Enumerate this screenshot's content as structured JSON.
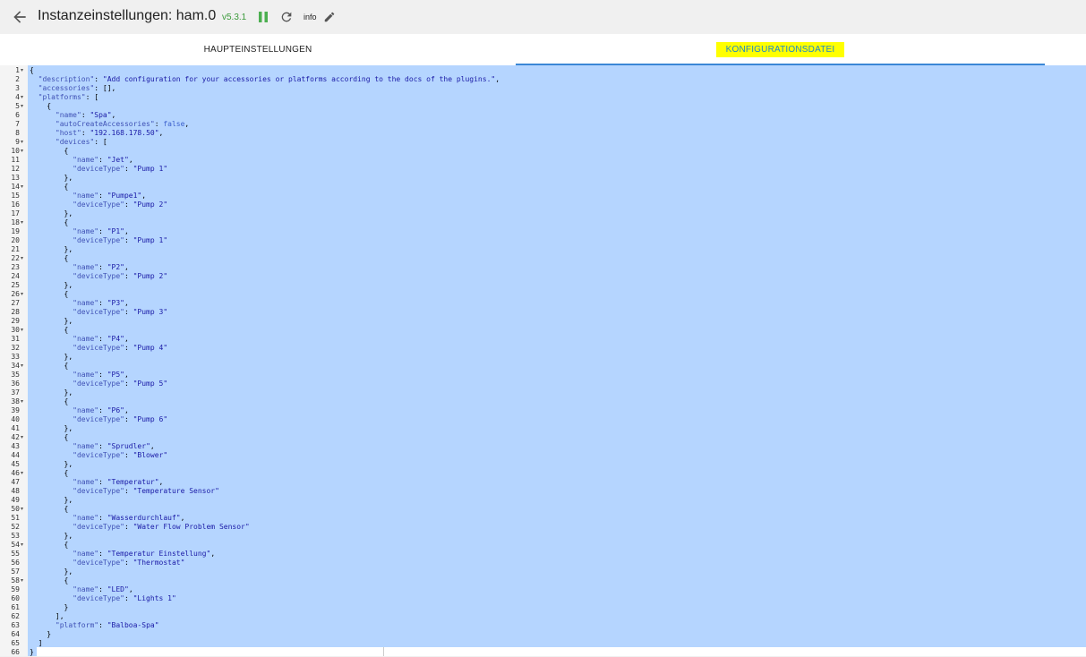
{
  "header": {
    "title": "Instanzeinstellungen: ham.0",
    "version": "v5.3.1",
    "info_label": "info",
    "back_icon": "arrow-left-icon",
    "pause_icon": "pause-icon",
    "reload_icon": "reload-icon",
    "edit_icon": "pencil-icon"
  },
  "tabs": [
    {
      "label": "HAUPTEINSTELLUNGEN",
      "active": false
    },
    {
      "label": "KONFIGURATIONSDATEI",
      "active": true
    }
  ],
  "colors": {
    "accent": "#3b87d6",
    "highlight": "#ffff00",
    "version": "#3a9a3a",
    "selection": "#b5d5ff"
  },
  "editor": {
    "lines": [
      "{",
      "  \"description\": \"Add configuration for your accessories or platforms according to the docs of the plugins.\",",
      "  \"accessories\": [],",
      "  \"platforms\": [",
      "    {",
      "      \"name\": \"Spa\",",
      "      \"autoCreateAccessories\": false,",
      "      \"host\": \"192.168.178.50\",",
      "      \"devices\": [",
      "        {",
      "          \"name\": \"Jet\",",
      "          \"deviceType\": \"Pump 1\"",
      "        },",
      "        {",
      "          \"name\": \"Pumpe1\",",
      "          \"deviceType\": \"Pump 2\"",
      "        },",
      "        {",
      "          \"name\": \"P1\",",
      "          \"deviceType\": \"Pump 1\"",
      "        },",
      "        {",
      "          \"name\": \"P2\",",
      "          \"deviceType\": \"Pump 2\"",
      "        },",
      "        {",
      "          \"name\": \"P3\",",
      "          \"deviceType\": \"Pump 3\"",
      "        },",
      "        {",
      "          \"name\": \"P4\",",
      "          \"deviceType\": \"Pump 4\"",
      "        },",
      "        {",
      "          \"name\": \"P5\",",
      "          \"deviceType\": \"Pump 5\"",
      "        },",
      "        {",
      "          \"name\": \"P6\",",
      "          \"deviceType\": \"Pump 6\"",
      "        },",
      "        {",
      "          \"name\": \"Sprudler\",",
      "          \"deviceType\": \"Blower\"",
      "        },",
      "        {",
      "          \"name\": \"Temperatur\",",
      "          \"deviceType\": \"Temperature Sensor\"",
      "        },",
      "        {",
      "          \"name\": \"Wasserdurchlauf\",",
      "          \"deviceType\": \"Water Flow Problem Sensor\"",
      "        },",
      "        {",
      "          \"name\": \"Temperatur Einstellung\",",
      "          \"deviceType\": \"Thermostat\"",
      "        },",
      "        {",
      "          \"name\": \"LED\",",
      "          \"deviceType\": \"Lights 1\"",
      "        }",
      "      ],",
      "      \"platform\": \"Balboa-Spa\"",
      "    }",
      "  ]",
      "}"
    ],
    "fold_lines": [
      1,
      4,
      5,
      9,
      10,
      14,
      18,
      22,
      26,
      30,
      34,
      38,
      42,
      46,
      50,
      54,
      58
    ]
  }
}
